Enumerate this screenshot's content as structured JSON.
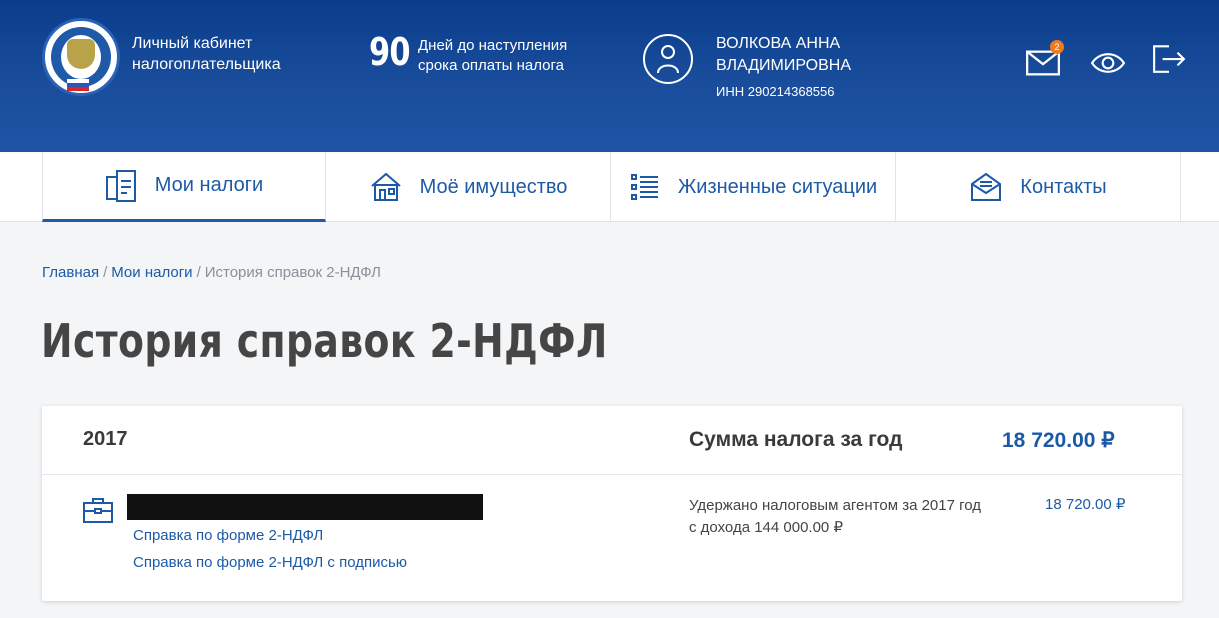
{
  "header": {
    "app_title": "Личный кабинет налогоплательщика",
    "deadline_days": "90",
    "deadline_text": "Дней до наступления срока оплаты налога",
    "user_name": "ВОЛКОВА АННА ВЛАДИМИРОВНА",
    "inn": "ИНН 290214368556",
    "messages_badge": "2",
    "icons": [
      "emblem",
      "user-icon",
      "envelope-icon",
      "eye-icon",
      "logout-icon"
    ],
    "colors": {
      "brand_blue": "#1d5aa6",
      "badge_orange": "#f07a20"
    }
  },
  "nav": {
    "items": [
      {
        "label": "Мои налоги",
        "icon": "tax-documents-icon",
        "active": true
      },
      {
        "label": "Моё имущество",
        "icon": "house-icon",
        "active": false
      },
      {
        "label": "Жизненные ситуации",
        "icon": "list-icon",
        "active": false
      },
      {
        "label": "Контакты",
        "icon": "envelope-open-icon",
        "active": false
      }
    ]
  },
  "breadcrumb": {
    "home": "Главная",
    "sep1": "/",
    "parent": "Мои налоги",
    "sep2": "/",
    "current": "История справок 2-НДФЛ"
  },
  "page_title": "История справок 2-НДФЛ",
  "card": {
    "year": "2017",
    "sum_label": "Сумма налога за год",
    "sum_value": "18 720.00 ₽",
    "links": [
      "Справка по форме 2-НДФЛ",
      "Справка по форме 2-НДФЛ с подписью"
    ],
    "withheld_text": "Удержано налоговым агентом за 2017 год с дохода 144 000.00 ₽",
    "withheld_value": "18 720.00 ₽"
  }
}
